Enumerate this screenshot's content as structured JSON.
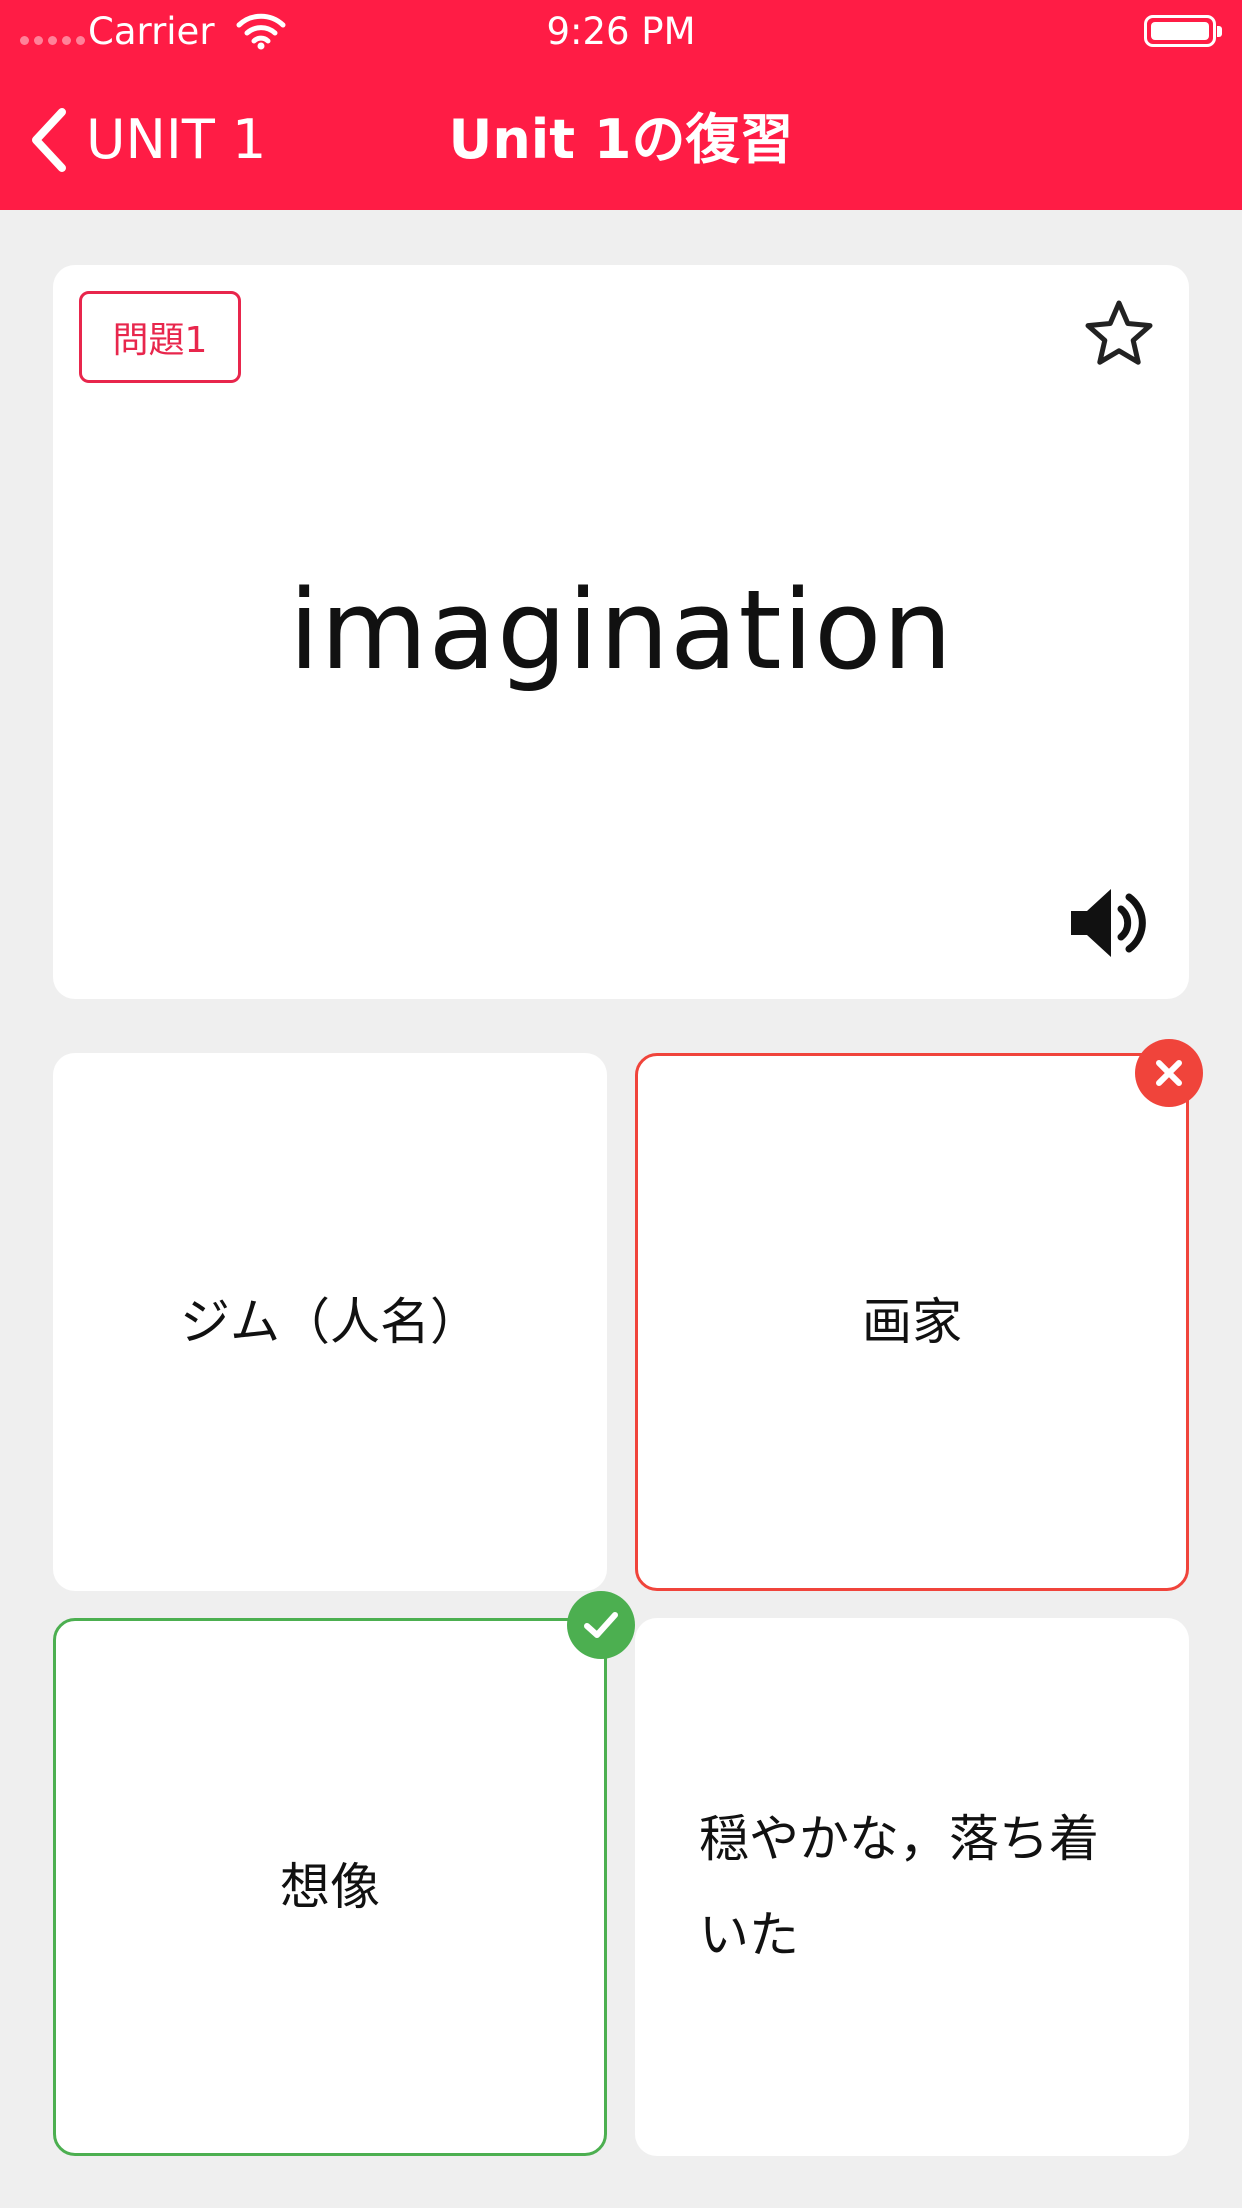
{
  "status_bar": {
    "carrier": "Carrier",
    "time": "9:26 PM"
  },
  "nav": {
    "back_label": "UNIT 1",
    "title": "Unit 1の復習"
  },
  "question": {
    "badge": "問題1",
    "word": "imagination"
  },
  "choices": [
    {
      "label": "ジム（人名）",
      "state": "default"
    },
    {
      "label": "画家",
      "state": "wrong"
    },
    {
      "label": "想像",
      "state": "correct"
    },
    {
      "label": "穏やかな，落ち着いた",
      "state": "default"
    }
  ],
  "colors": {
    "header": "#ff1c45",
    "wrong": "#f0443b",
    "correct": "#4caf50",
    "badge": "#e8264c"
  },
  "icons": [
    "wifi-icon",
    "battery-icon",
    "chevron-left-icon",
    "star-outline-icon",
    "speaker-icon",
    "close-icon",
    "checkmark-icon"
  ]
}
